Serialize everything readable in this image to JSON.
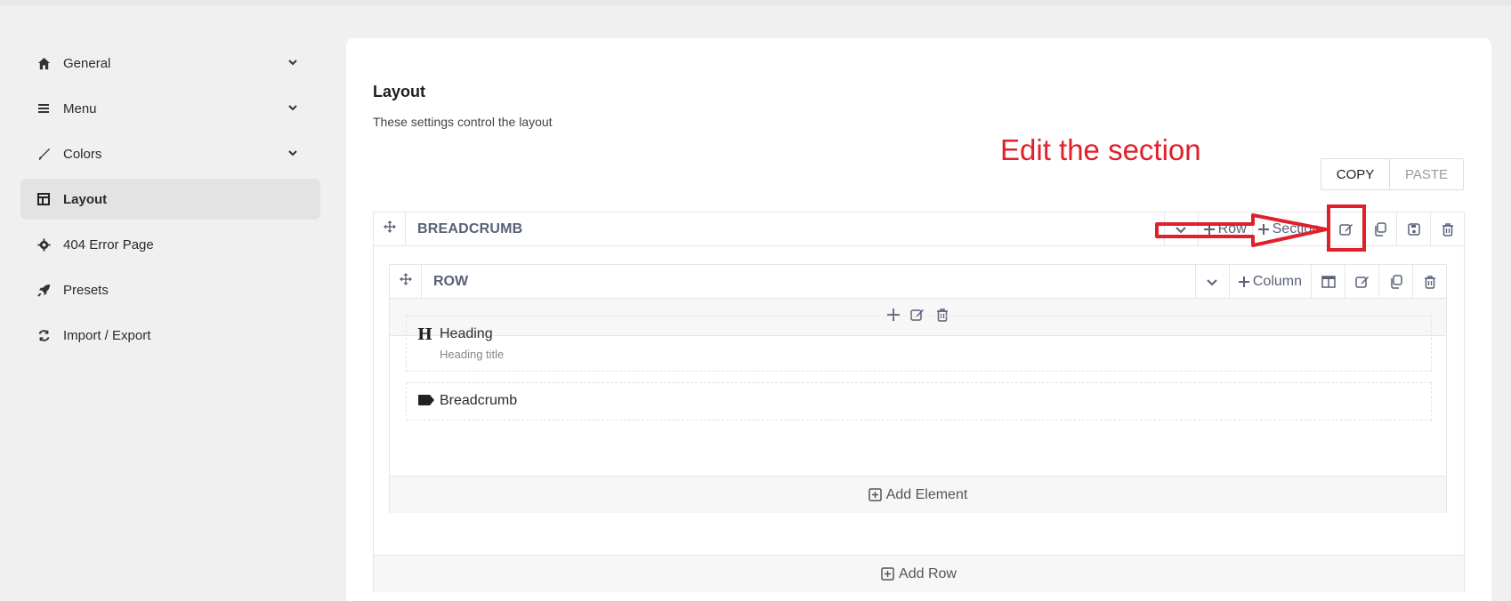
{
  "sidebar": {
    "items": [
      {
        "label": "General",
        "icon": "home-icon",
        "expandable": true
      },
      {
        "label": "Menu",
        "icon": "menu-lines-icon",
        "expandable": true
      },
      {
        "label": "Colors",
        "icon": "brush-icon",
        "expandable": true
      },
      {
        "label": "Layout",
        "icon": "layout-icon",
        "active": true
      },
      {
        "label": "404 Error Page",
        "icon": "gear-icon"
      },
      {
        "label": "Presets",
        "icon": "rocket-icon"
      },
      {
        "label": "Import / Export",
        "icon": "sync-icon"
      }
    ]
  },
  "main": {
    "title": "Layout",
    "subtitle": "These settings control the layout",
    "copy_label": "COPY",
    "paste_label": "PASTE",
    "section": {
      "title": "BREADCRUMB",
      "add_row_label": "Row",
      "add_section_label": "Section",
      "row": {
        "title": "ROW",
        "add_column_label": "Column",
        "elements": [
          {
            "name": "Heading",
            "subtitle": "Heading title",
            "icon": "heading-icon"
          },
          {
            "name": "Breadcrumb",
            "icon": "tag-icon"
          }
        ],
        "add_element_label": "Add Element"
      },
      "add_row_footer_label": "Add Row"
    }
  },
  "annotation": {
    "text": "Edit the section",
    "color": "#e0202a"
  },
  "colors": {
    "accent_text": "#5a6078",
    "active_bg": "#e3e3e3"
  }
}
